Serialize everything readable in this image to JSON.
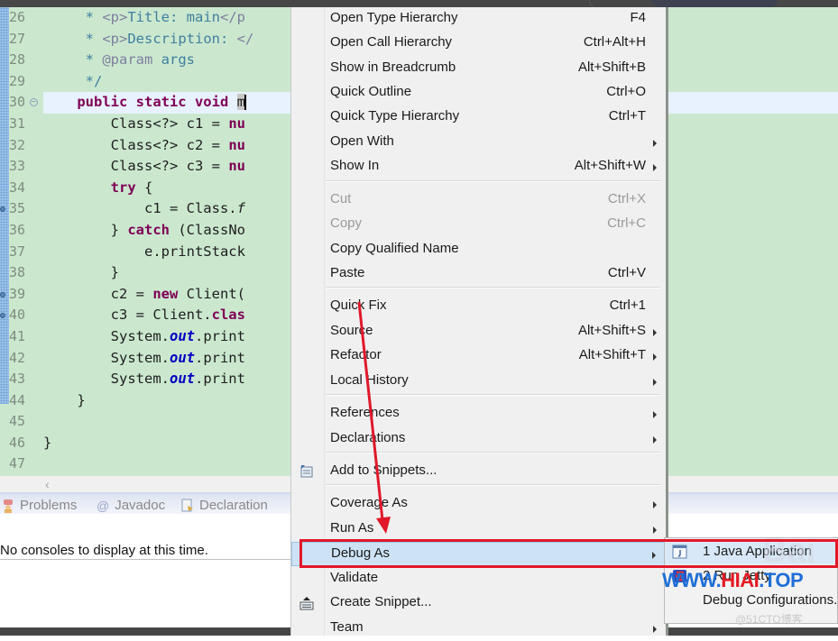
{
  "editor": {
    "lines": [
      {
        "no": "26",
        "segments": [
          {
            "t": "     * ",
            "c": "cmt"
          },
          {
            "t": "<p>",
            "c": "tag"
          },
          {
            "t": "Title: main",
            "c": "cmt"
          },
          {
            "t": "</p",
            "c": "tag"
          }
        ]
      },
      {
        "no": "27",
        "segments": [
          {
            "t": "     * ",
            "c": "cmt"
          },
          {
            "t": "<p>",
            "c": "tag"
          },
          {
            "t": "Description: ",
            "c": "cmt"
          },
          {
            "t": "</",
            "c": "tag"
          }
        ]
      },
      {
        "no": "28",
        "segments": [
          {
            "t": "     * ",
            "c": "cmt"
          },
          {
            "t": "@param",
            "c": "tag"
          },
          {
            "t": " args",
            "c": "cmt"
          }
        ]
      },
      {
        "no": "29",
        "segments": [
          {
            "t": "     */",
            "c": "cmt"
          }
        ]
      },
      {
        "no": "30",
        "fold": true,
        "highlight": true,
        "segments": [
          {
            "t": "    ",
            "c": ""
          },
          {
            "t": "public static void",
            "c": "kw"
          },
          {
            "t": " ",
            "c": ""
          },
          {
            "t": "m",
            "c": "selm"
          },
          {
            "t": "",
            "c": "caret"
          }
        ]
      },
      {
        "no": "31",
        "segments": [
          {
            "t": "        Class<?> c1 = ",
            "c": ""
          },
          {
            "t": "nu",
            "c": "kw"
          }
        ]
      },
      {
        "no": "32",
        "segments": [
          {
            "t": "        Class<?> c2 = ",
            "c": ""
          },
          {
            "t": "nu",
            "c": "kw"
          }
        ]
      },
      {
        "no": "33",
        "segments": [
          {
            "t": "        Class<?> c3 = ",
            "c": ""
          },
          {
            "t": "nu",
            "c": "kw"
          }
        ]
      },
      {
        "no": "34",
        "segments": [
          {
            "t": "        ",
            "c": ""
          },
          {
            "t": "try",
            "c": "kw"
          },
          {
            "t": " {",
            "c": ""
          }
        ]
      },
      {
        "no": "35",
        "marker": true,
        "segments": [
          {
            "t": "            c1 = Class.",
            "c": ""
          },
          {
            "t": "f",
            "c": "it"
          },
          {
            "t": "                                    ",
            "c": ""
          },
          {
            "t": "\"",
            "c": "str"
          },
          {
            "t": ");",
            "c": ""
          }
        ]
      },
      {
        "no": "36",
        "segments": [
          {
            "t": "        } ",
            "c": ""
          },
          {
            "t": "catch",
            "c": "kw"
          },
          {
            "t": " (ClassNo",
            "c": ""
          }
        ]
      },
      {
        "no": "37",
        "segments": [
          {
            "t": "            e.printStack",
            "c": ""
          }
        ]
      },
      {
        "no": "38",
        "segments": [
          {
            "t": "        }",
            "c": ""
          }
        ]
      },
      {
        "no": "39",
        "marker": true,
        "segments": [
          {
            "t": "        c2 = ",
            "c": ""
          },
          {
            "t": "new",
            "c": "kw"
          },
          {
            "t": " Client(",
            "c": ""
          }
        ]
      },
      {
        "no": "40",
        "marker": true,
        "segments": [
          {
            "t": "        c3 = Client.",
            "c": ""
          },
          {
            "t": "clas",
            "c": "kw"
          }
        ]
      },
      {
        "no": "41",
        "segments": [
          {
            "t": "        System.",
            "c": ""
          },
          {
            "t": "out",
            "c": "fld"
          },
          {
            "t": ".print",
            "c": ""
          }
        ]
      },
      {
        "no": "42",
        "segments": [
          {
            "t": "        System.",
            "c": ""
          },
          {
            "t": "out",
            "c": "fld"
          },
          {
            "t": ".print",
            "c": ""
          }
        ]
      },
      {
        "no": "43",
        "segments": [
          {
            "t": "        System.",
            "c": ""
          },
          {
            "t": "out",
            "c": "fld"
          },
          {
            "t": ".print",
            "c": ""
          }
        ]
      },
      {
        "no": "44",
        "segments": [
          {
            "t": "    }",
            "c": ""
          }
        ]
      },
      {
        "no": "45",
        "segments": []
      },
      {
        "no": "46",
        "segments": [
          {
            "t": "}",
            "c": ""
          }
        ]
      },
      {
        "no": "47",
        "segments": []
      }
    ]
  },
  "panel": {
    "tabs": [
      "Problems",
      "Javadoc",
      "Declaration"
    ],
    "console_message": "No consoles to display at this time."
  },
  "context_menu": {
    "items": [
      {
        "label": "Open Type Hierarchy",
        "accel": "F4"
      },
      {
        "label": "Open Call Hierarchy",
        "accel": "Ctrl+Alt+H"
      },
      {
        "label": "Show in Breadcrumb",
        "accel": "Alt+Shift+B"
      },
      {
        "label": "Quick Outline",
        "accel": "Ctrl+O"
      },
      {
        "label": "Quick Type Hierarchy",
        "accel": "Ctrl+T"
      },
      {
        "label": "Open With",
        "accel": "",
        "submenu": true
      },
      {
        "label": "Show In",
        "accel": "Alt+Shift+W",
        "submenu": true
      },
      {
        "label": "Cut",
        "accel": "Ctrl+X",
        "disabled": true
      },
      {
        "label": "Copy",
        "accel": "Ctrl+C",
        "disabled": true
      },
      {
        "label": "Copy Qualified Name",
        "accel": ""
      },
      {
        "label": "Paste",
        "accel": "Ctrl+V"
      },
      {
        "label": "Quick Fix",
        "accel": "Ctrl+1"
      },
      {
        "label": "Source",
        "accel": "Alt+Shift+S",
        "submenu": true
      },
      {
        "label": "Refactor",
        "accel": "Alt+Shift+T",
        "submenu": true
      },
      {
        "label": "Local History",
        "accel": "",
        "submenu": true
      },
      {
        "label": "References",
        "accel": "",
        "submenu": true
      },
      {
        "label": "Declarations",
        "accel": "",
        "submenu": true
      },
      {
        "label": "Add to Snippets...",
        "accel": "",
        "icon": "add-snippet-icon"
      },
      {
        "label": "Coverage As",
        "accel": "",
        "submenu": true
      },
      {
        "label": "Run As",
        "accel": "",
        "submenu": true
      },
      {
        "label": "Debug As",
        "accel": "",
        "submenu": true,
        "selected": true
      },
      {
        "label": "Validate",
        "accel": ""
      },
      {
        "label": "Create Snippet...",
        "accel": "",
        "icon": "create-snippet-icon"
      },
      {
        "label": "Team",
        "accel": "",
        "submenu": true
      }
    ]
  },
  "debug_submenu": {
    "items": [
      {
        "label": "1 Java Application",
        "icon": "java-app-icon",
        "selected": true
      },
      {
        "label": "2 Run Jetty",
        "icon": "jetty-icon"
      },
      {
        "label": "Debug Configurations...",
        "icon": ""
      }
    ]
  },
  "annotations": {
    "highlight_color": "#e0182a",
    "watermark_prefix": "WWW.",
    "watermark_mid": "HIAI",
    "watermark_suffix": ".TOP",
    "watermark_51cto": "@51CTO博客",
    "watermark_baidu": "Bai"
  }
}
